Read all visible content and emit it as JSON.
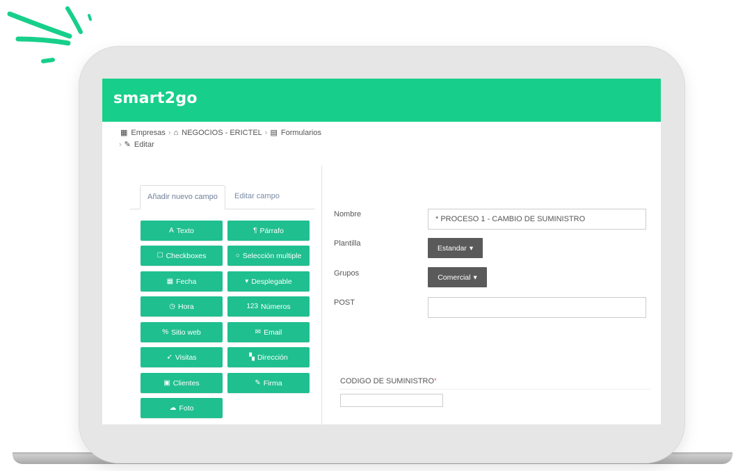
{
  "app": {
    "logo_text": "smart2go",
    "brand_color": "#17cf8a",
    "button_color": "#1fbf8f",
    "dropdown_color": "#5a5a5a"
  },
  "breadcrumb": [
    {
      "icon": "building-icon",
      "label": "Empresas"
    },
    {
      "icon": "home-icon",
      "label": "NEGOCIOS - ERICTEL"
    },
    {
      "icon": "document-icon",
      "label": "Formularios"
    },
    {
      "icon": "edit-icon",
      "label": "Editar"
    }
  ],
  "tabs": {
    "add_field": "Añadir nuevo campo",
    "edit_field": "Editar campo"
  },
  "field_buttons": [
    {
      "icon": "text-icon",
      "label": "Texto"
    },
    {
      "icon": "paragraph-icon",
      "label": "Párrafo"
    },
    {
      "icon": "checkbox-icon",
      "label": "Checkboxes"
    },
    {
      "icon": "radio-icon",
      "label": "Selección multiple"
    },
    {
      "icon": "calendar-icon",
      "label": "Fecha"
    },
    {
      "icon": "caret-down-icon",
      "label": "Desplegable"
    },
    {
      "icon": "clock-icon",
      "label": "Hora"
    },
    {
      "icon": "numbers-icon",
      "label": "Números"
    },
    {
      "icon": "link-icon",
      "label": "Sitio web"
    },
    {
      "icon": "envelope-icon",
      "label": "Email"
    },
    {
      "icon": "location-arrow-icon",
      "label": "Visitas"
    },
    {
      "icon": "map-icon",
      "label": "Dirección"
    },
    {
      "icon": "id-card-icon",
      "label": "Clientes"
    },
    {
      "icon": "pen-icon",
      "label": "Firma"
    },
    {
      "icon": "cloud-icon",
      "label": "Foto"
    }
  ],
  "form": {
    "nombre_label": "Nombre",
    "nombre_value": "* PROCESO 1 - CAMBIO DE SUMINISTRO",
    "plantilla_label": "Plantilla",
    "plantilla_value": "Estandar",
    "grupos_label": "Grupos",
    "grupos_value": "Comercial",
    "post_label": "POST",
    "post_value": "",
    "codigo_label": "CODIGO DE SUMINISTRO",
    "codigo_required_mark": "*",
    "codigo_value": ""
  }
}
